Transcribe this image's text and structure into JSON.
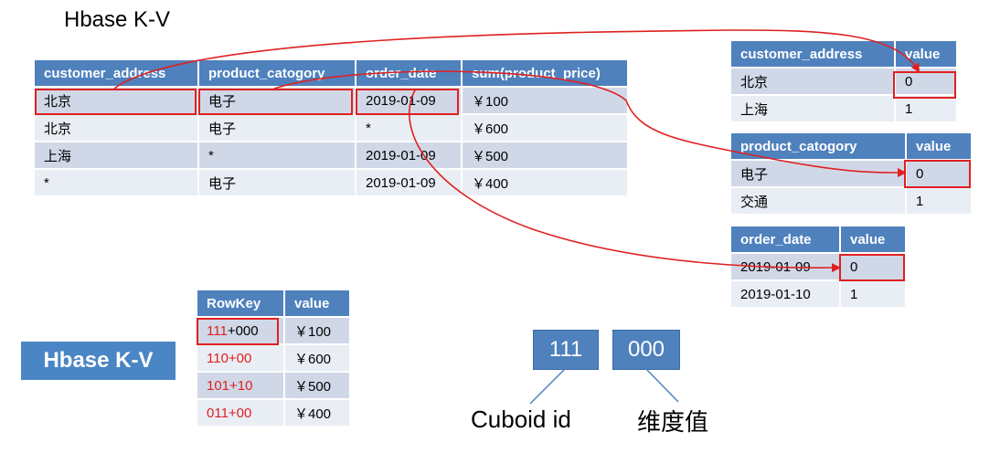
{
  "top_title": "Hbase K-V",
  "main_table": {
    "headers": [
      "customer_address",
      "product_catogory",
      "order_date",
      "sum(product_price)"
    ],
    "rows": [
      [
        "北京",
        "电子",
        "2019-01-09",
        "￥100"
      ],
      [
        "北京",
        "电子",
        "*",
        "￥600"
      ],
      [
        "上海",
        "*",
        "2019-01-09",
        "￥500"
      ],
      [
        "*",
        "电子",
        "2019-01-09",
        "￥400"
      ]
    ]
  },
  "dict_address": {
    "headers": [
      "customer_address",
      "value"
    ],
    "rows": [
      [
        "北京",
        "0"
      ],
      [
        "上海",
        "1"
      ]
    ]
  },
  "dict_category": {
    "headers": [
      "product_catogory",
      "value"
    ],
    "rows": [
      [
        "电子",
        "0"
      ],
      [
        "交通",
        "1"
      ]
    ]
  },
  "dict_date": {
    "headers": [
      "order_date",
      "value"
    ],
    "rows": [
      [
        "2019-01-09",
        "0"
      ],
      [
        "2019-01-10",
        "1"
      ]
    ]
  },
  "kv_label": "Hbase K-V",
  "rowkey_table": {
    "headers": [
      "RowKey",
      "value"
    ],
    "rows": [
      {
        "cuboid": "111",
        "dims": "+000",
        "value": "￥100"
      },
      {
        "cuboid": "110",
        "dims": "+00",
        "value": "￥600"
      },
      {
        "cuboid": "101",
        "dims": "+10",
        "value": "￥500"
      },
      {
        "cuboid": "011",
        "dims": "+00",
        "value": "￥400"
      }
    ]
  },
  "legend": {
    "box1": "111",
    "box2": "000",
    "caption1": "Cuboid id",
    "caption2": "维度值"
  },
  "colors": {
    "header": "#4f81bd",
    "row_odd": "#d0d8e8",
    "row_even": "#e9edf4",
    "highlight": "#e02020"
  }
}
